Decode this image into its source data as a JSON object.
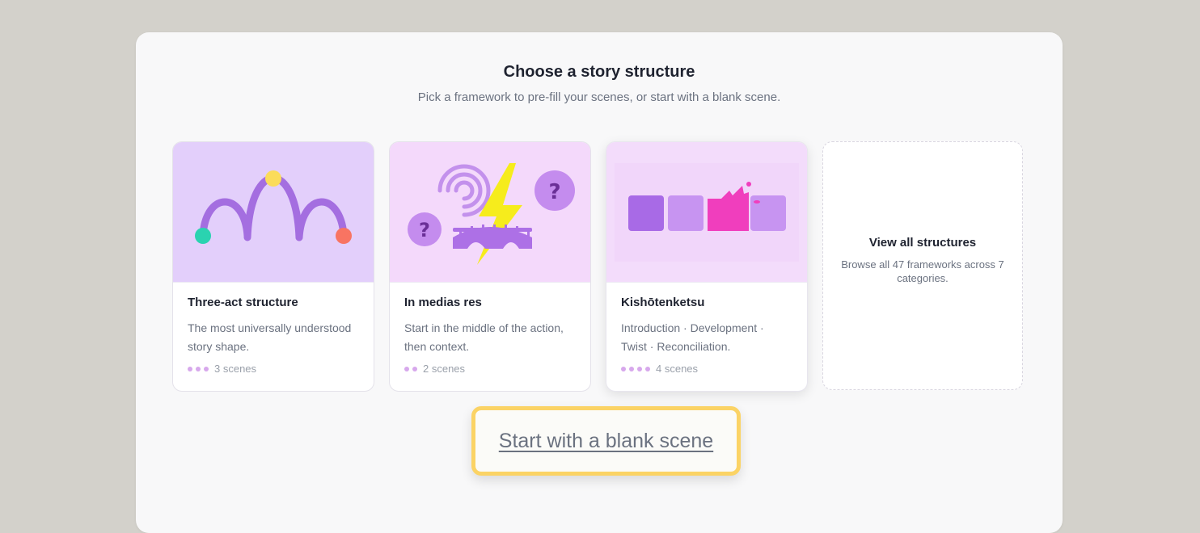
{
  "header": {
    "title": "Choose a story structure",
    "subtitle": "Pick a framework to pre-fill your scenes, or start with a blank scene."
  },
  "cards": [
    {
      "name": "Three-act structure",
      "description": "The most universally understood story shape.",
      "scenes_label": "3 scenes",
      "scene_count": 3,
      "thumb_color": "#e3cffb",
      "icon": "three-act-arc-illustration"
    },
    {
      "name": "In medias res",
      "description": "Start in the middle of the action, then context.",
      "scenes_label": "2 scenes",
      "scene_count": 2,
      "thumb_color": "#f4d9fb",
      "icon": "lightning-bridge-illustration"
    },
    {
      "name": "Kishōtenketsu",
      "description": "Introduction · Development · Twist · Reconciliation.",
      "scenes_label": "4 scenes",
      "scene_count": 4,
      "thumb_color": "#f3dcfb",
      "icon": "four-panels-twist-illustration"
    }
  ],
  "view_all": {
    "title": "View all structures",
    "description": "Browse all 47 frameworks across 7 categories."
  },
  "blank_button": {
    "label": "Start with a blank scene",
    "highlight_color": "#fbd365"
  }
}
